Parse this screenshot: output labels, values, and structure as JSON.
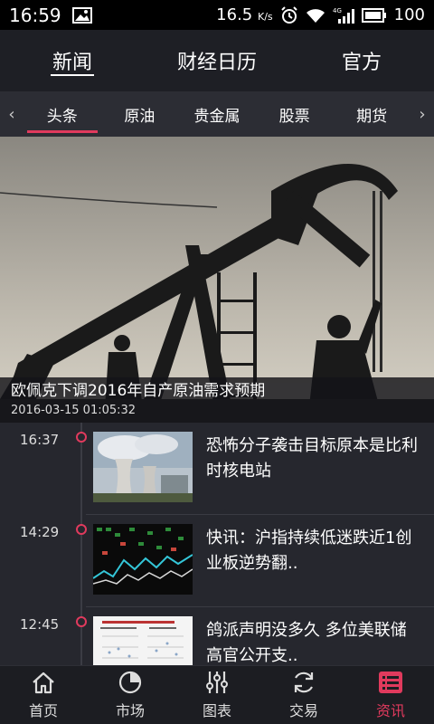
{
  "status_bar": {
    "time": "16:59",
    "net_speed": "16.5",
    "net_unit": "K/s",
    "network": "4G",
    "battery": "100",
    "icons": [
      "image-icon",
      "alarm-icon",
      "wifi-icon",
      "signal-icon",
      "battery-icon"
    ]
  },
  "top_tabs": [
    {
      "label": "新闻",
      "active": true
    },
    {
      "label": "财经日历",
      "active": false
    },
    {
      "label": "官方",
      "active": false
    }
  ],
  "categories": {
    "items": [
      "头条",
      "原油",
      "贵金属",
      "股票",
      "期货"
    ],
    "active": "头条",
    "prev_icon": "chevron-left-icon",
    "next_icon": "chevron-right-icon"
  },
  "hero": {
    "title": "欧佩克下调2016年自产原油需求预期",
    "time": "2016-03-15 01:05:32",
    "image": "oil-pump-silhouette"
  },
  "feed": [
    {
      "time": "16:37",
      "headline": "恐怖分子袭击目标原本是比利时核电站",
      "thumb": "nuclear-plant-image"
    },
    {
      "time": "14:29",
      "headline": "快讯：沪指持续低迷跌近1创业板逆势翻..",
      "thumb": "stock-chart-image"
    },
    {
      "time": "12:45",
      "headline": "鸽派声明没多久 多位美联储高官公开支..",
      "thumb": "document-chart-image"
    }
  ],
  "bottom_nav": [
    {
      "label": "首页",
      "icon": "home-icon",
      "active": false
    },
    {
      "label": "市场",
      "icon": "pie-chart-icon",
      "active": false
    },
    {
      "label": "图表",
      "icon": "sliders-icon",
      "active": false
    },
    {
      "label": "交易",
      "icon": "refresh-icon",
      "active": false
    },
    {
      "label": "资讯",
      "icon": "news-list-icon",
      "active": true
    }
  ],
  "colors": {
    "accent": "#e03a5d",
    "background": "#24252c",
    "status_bar": "#000000"
  }
}
